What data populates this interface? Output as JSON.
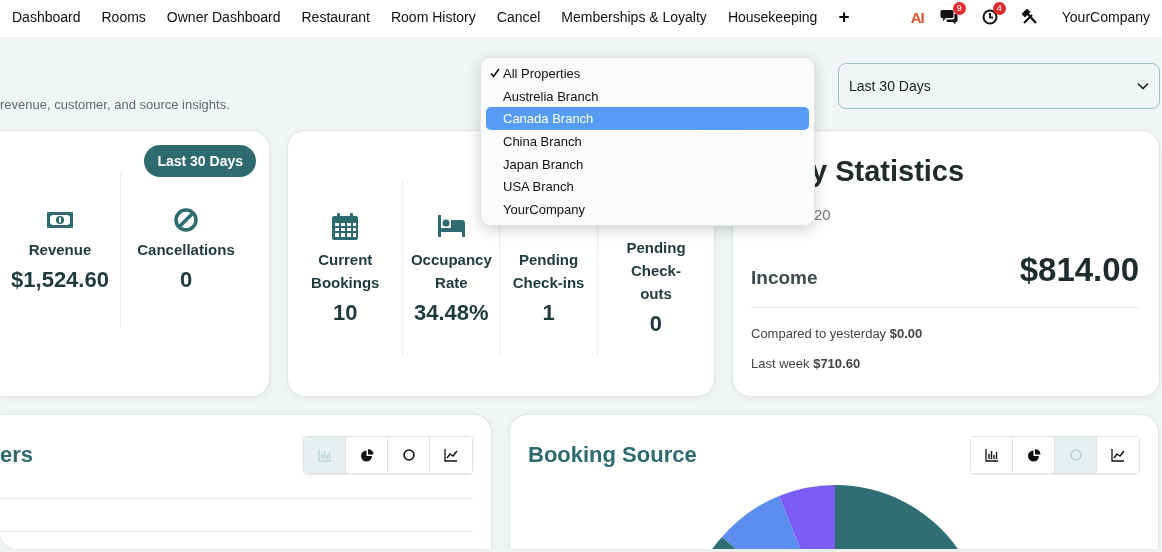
{
  "nav": {
    "links": [
      "Dashboard",
      "Rooms",
      "Owner Dashboard",
      "Restaurant",
      "Room History",
      "Cancel",
      "Memberships & Loyalty",
      "Housekeeping"
    ],
    "add_label": "+",
    "ai_logo": "AI",
    "messages_badge": "9",
    "activities_badge": "4",
    "company": "YourCompany"
  },
  "header": {
    "subtitle": "revenue, customer, and source insights.",
    "period_select": "Last 30 Days"
  },
  "property_dropdown": {
    "items": [
      {
        "label": "All Properties",
        "checked": true,
        "highlighted": false
      },
      {
        "label": "Austrelia Branch",
        "checked": false,
        "highlighted": false
      },
      {
        "label": "Canada Branch",
        "checked": false,
        "highlighted": true
      },
      {
        "label": "China Branch",
        "checked": false,
        "highlighted": false
      },
      {
        "label": "Japan Branch",
        "checked": false,
        "highlighted": false
      },
      {
        "label": "USA Branch",
        "checked": false,
        "highlighted": false
      },
      {
        "label": "YourCompany",
        "checked": false,
        "highlighted": false
      }
    ]
  },
  "revenue_card": {
    "badge": "Last 30 Days",
    "stats": [
      {
        "label": "Revenue",
        "value": "$1,524.60"
      },
      {
        "label": "Cancellations",
        "value": "0"
      }
    ]
  },
  "bookings_card": {
    "stats": [
      {
        "label": "Current Bookings",
        "value": "10"
      },
      {
        "label": "Occupancy Rate",
        "value": "34.48%"
      },
      {
        "label": "Pending Check-ins",
        "value": "1"
      },
      {
        "label": "Pending Check-outs",
        "value": "0"
      }
    ]
  },
  "statistics_card": {
    "title": "y Statistics",
    "date": "-20",
    "income_label": "Income",
    "income_value": "$814.00",
    "compared_label": "Compared to yesterday",
    "compared_value": "$0.00",
    "last_week_label": "Last week",
    "last_week_value": "$710.60"
  },
  "customers_card": {
    "title": "ers",
    "chart_types": [
      {
        "kind": "bar",
        "selected": true
      },
      {
        "kind": "pie",
        "selected": false
      },
      {
        "kind": "donut",
        "selected": false
      },
      {
        "kind": "line",
        "selected": false
      }
    ]
  },
  "booking_source_card": {
    "title": "Booking Source",
    "chart_types": [
      {
        "kind": "bar",
        "selected": false
      },
      {
        "kind": "pie",
        "selected": false
      },
      {
        "kind": "donut",
        "selected": true
      },
      {
        "kind": "line",
        "selected": false
      }
    ]
  }
}
